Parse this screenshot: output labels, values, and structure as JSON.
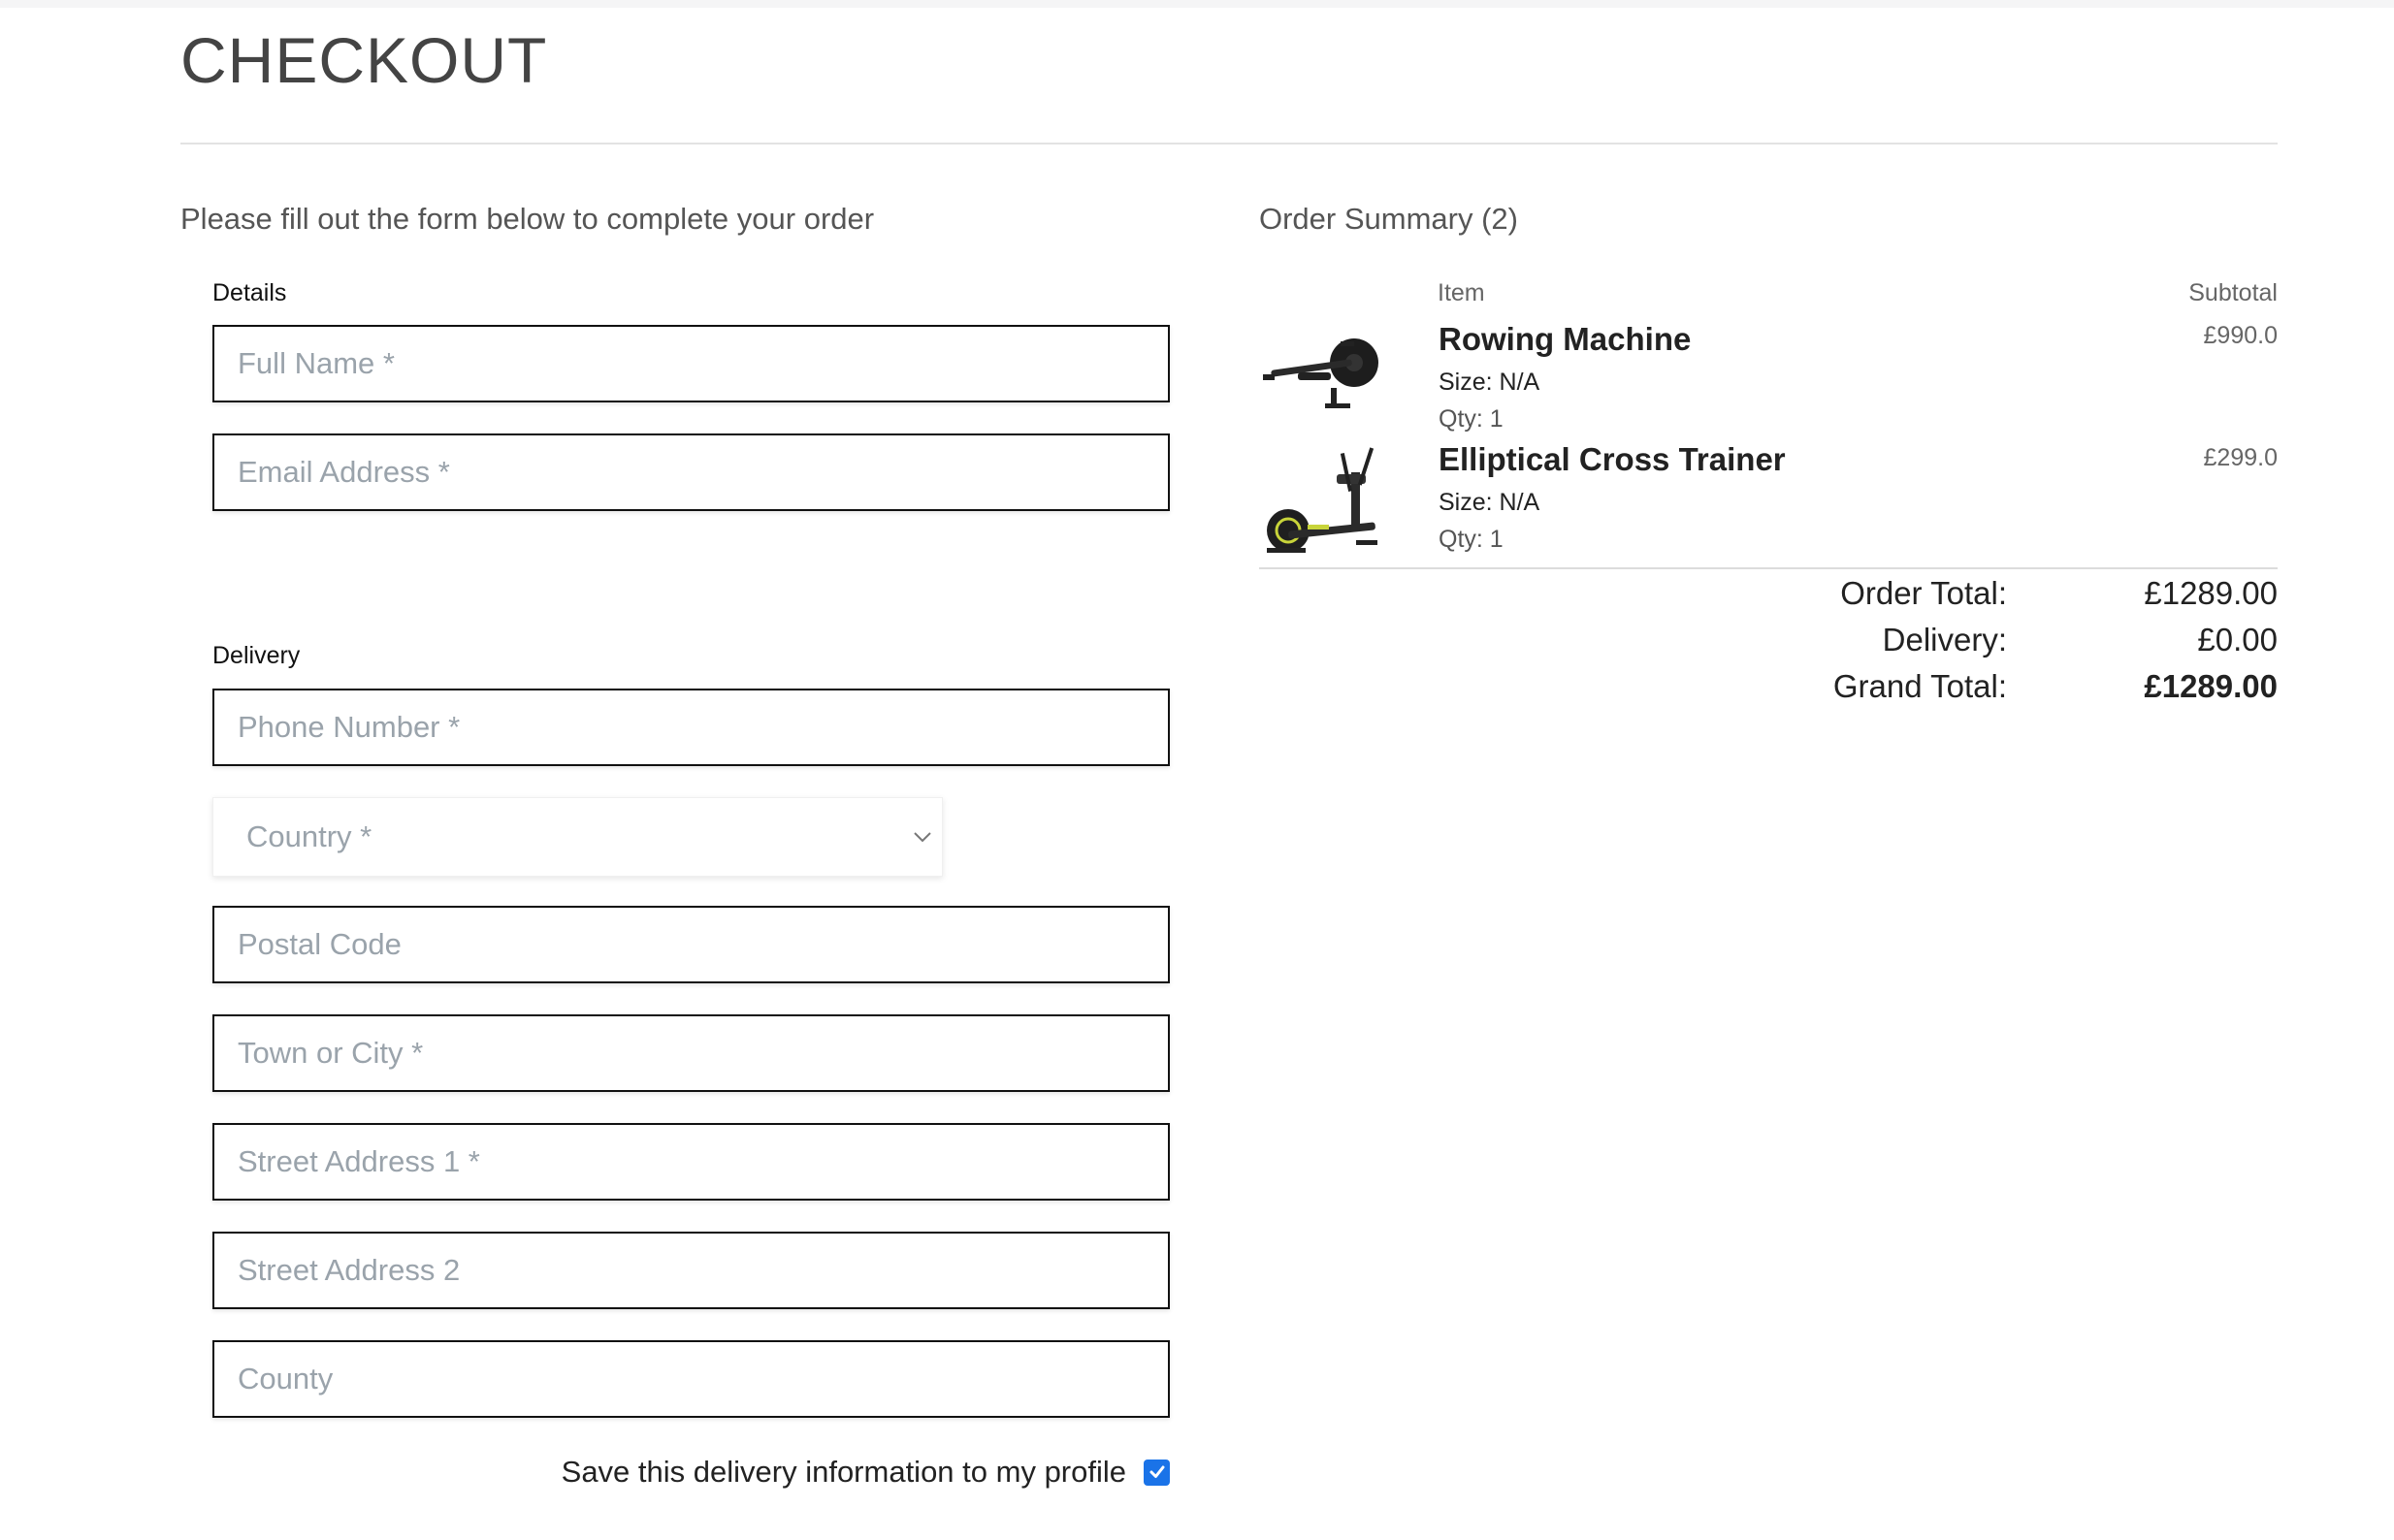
{
  "page": {
    "title": "CHECKOUT",
    "intro": "Please fill out the form below to complete your order"
  },
  "form": {
    "details_label": "Details",
    "delivery_label": "Delivery",
    "full_name": {
      "placeholder": "Full Name *",
      "value": ""
    },
    "email": {
      "placeholder": "Email Address *",
      "value": ""
    },
    "phone": {
      "placeholder": "Phone Number *",
      "value": ""
    },
    "country": {
      "selected": "Country *"
    },
    "postal_code": {
      "placeholder": "Postal Code",
      "value": ""
    },
    "town": {
      "placeholder": "Town or City *",
      "value": ""
    },
    "street1": {
      "placeholder": "Street Address 1 *",
      "value": ""
    },
    "street2": {
      "placeholder": "Street Address 2",
      "value": ""
    },
    "county": {
      "placeholder": "County",
      "value": ""
    },
    "save_label": "Save this delivery information to my profile",
    "save_checked": true
  },
  "summary": {
    "title": "Order Summary (2)",
    "col_item": "Item",
    "col_subtotal": "Subtotal",
    "items": [
      {
        "name": "Rowing Machine",
        "size": "Size: N/A",
        "qty": "Qty: 1",
        "subtotal": "£990.0",
        "icon": "rowing-machine-icon"
      },
      {
        "name": "Elliptical Cross Trainer",
        "size": "Size: N/A",
        "qty": "Qty: 1",
        "subtotal": "£299.0",
        "icon": "elliptical-trainer-icon"
      }
    ],
    "order_total_label": "Order Total:",
    "order_total_value": "£1289.00",
    "delivery_label": "Delivery:",
    "delivery_value": "£0.00",
    "grand_total_label": "Grand Total:",
    "grand_total_value": "£1289.00"
  },
  "colors": {
    "checkbox": "#1a73e8",
    "field_border": "#111111",
    "placeholder": "#9aa3ab"
  }
}
